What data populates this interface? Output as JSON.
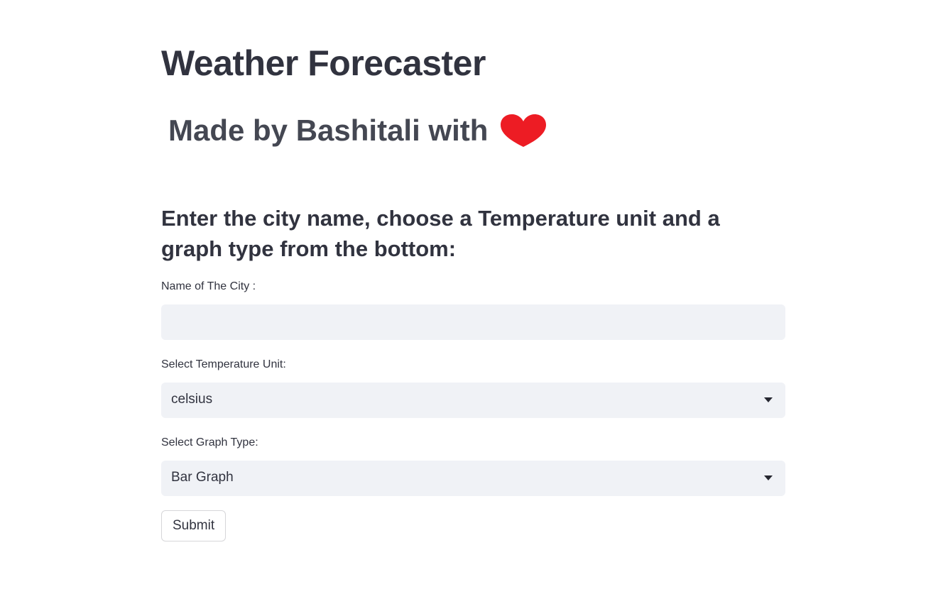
{
  "header": {
    "title": "Weather Forecaster",
    "credit_text": "Made by Bashitali with",
    "credit_icon": "heart-icon",
    "heart_color": "#ed1c24"
  },
  "instructions": {
    "text": "Enter the city name, choose a Temperature unit and a graph type from the bottom:"
  },
  "form": {
    "city": {
      "label": "Name of The City :",
      "value": "",
      "placeholder": ""
    },
    "temperature_unit": {
      "label": "Select Temperature Unit:",
      "selected": "celsius"
    },
    "graph_type": {
      "label": "Select Graph Type:",
      "selected": "Bar Graph"
    },
    "submit_label": "Submit"
  },
  "colors": {
    "text": "#31333f",
    "input_background": "#f0f2f6",
    "button_border": "#d6d6d9"
  }
}
